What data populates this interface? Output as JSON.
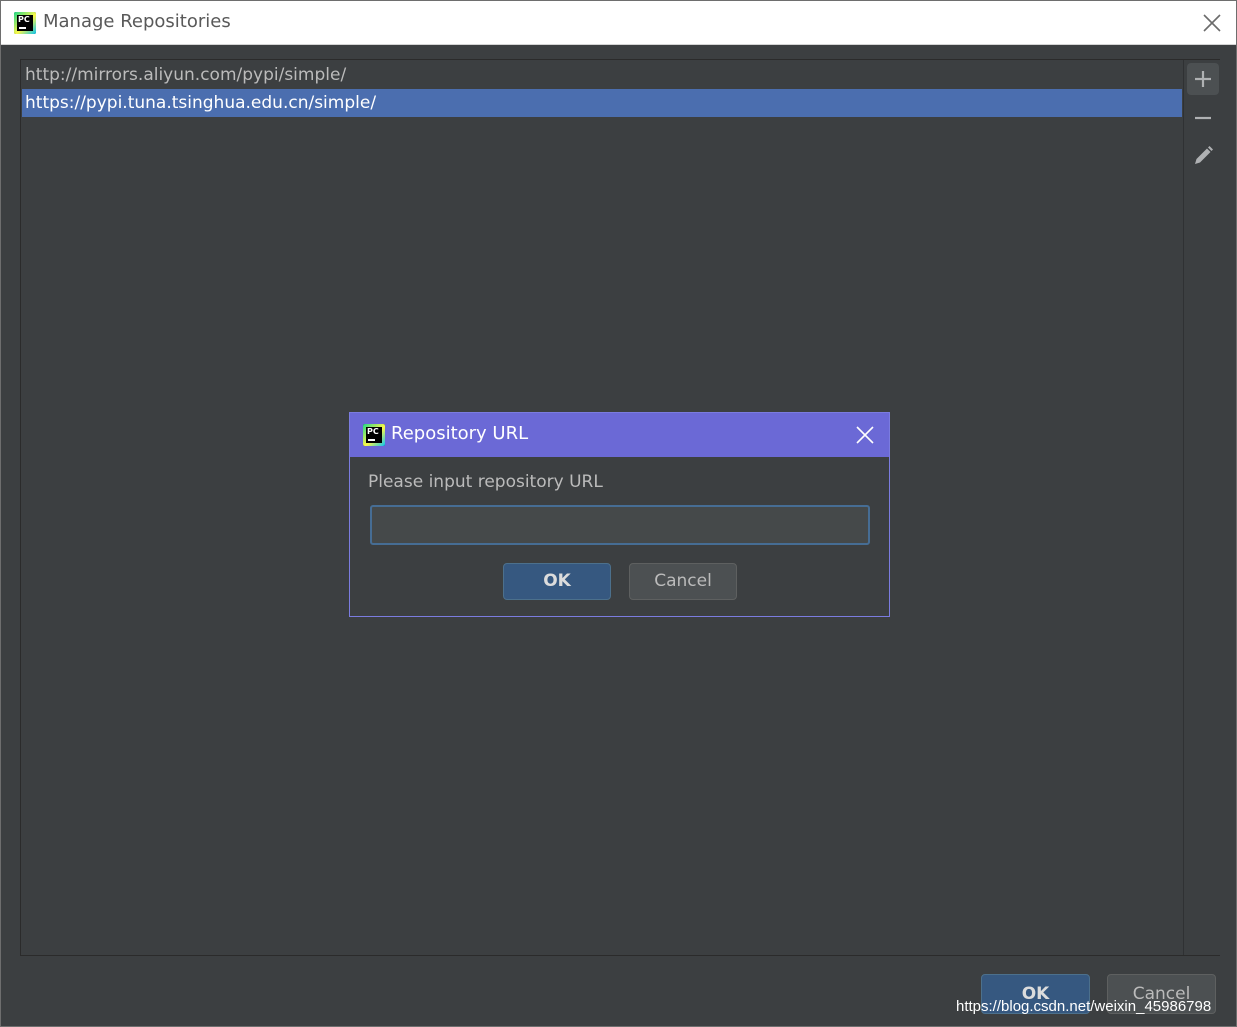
{
  "window": {
    "title": "Manage Repositories",
    "icon": "pycharm-icon"
  },
  "repositories": [
    {
      "url": "http://mirrors.aliyun.com/pypi/simple/",
      "selected": false
    },
    {
      "url": "https://pypi.tuna.tsinghua.edu.cn/simple/",
      "selected": true
    }
  ],
  "toolbar": {
    "add_icon": "plus-icon",
    "remove_icon": "minus-icon",
    "edit_icon": "pencil-icon"
  },
  "dialog": {
    "title": "Repository URL",
    "prompt": "Please input repository URL",
    "input_value": "",
    "ok_label": "OK",
    "cancel_label": "Cancel"
  },
  "footer": {
    "ok_label": "OK",
    "cancel_label": "Cancel"
  },
  "watermark": "https://blog.csdn.net/weixin_45986798",
  "colors": {
    "background": "#3c3f41",
    "selection": "#4b6eaf",
    "dialog_title": "#6b69d6",
    "primary_button": "#365880"
  }
}
